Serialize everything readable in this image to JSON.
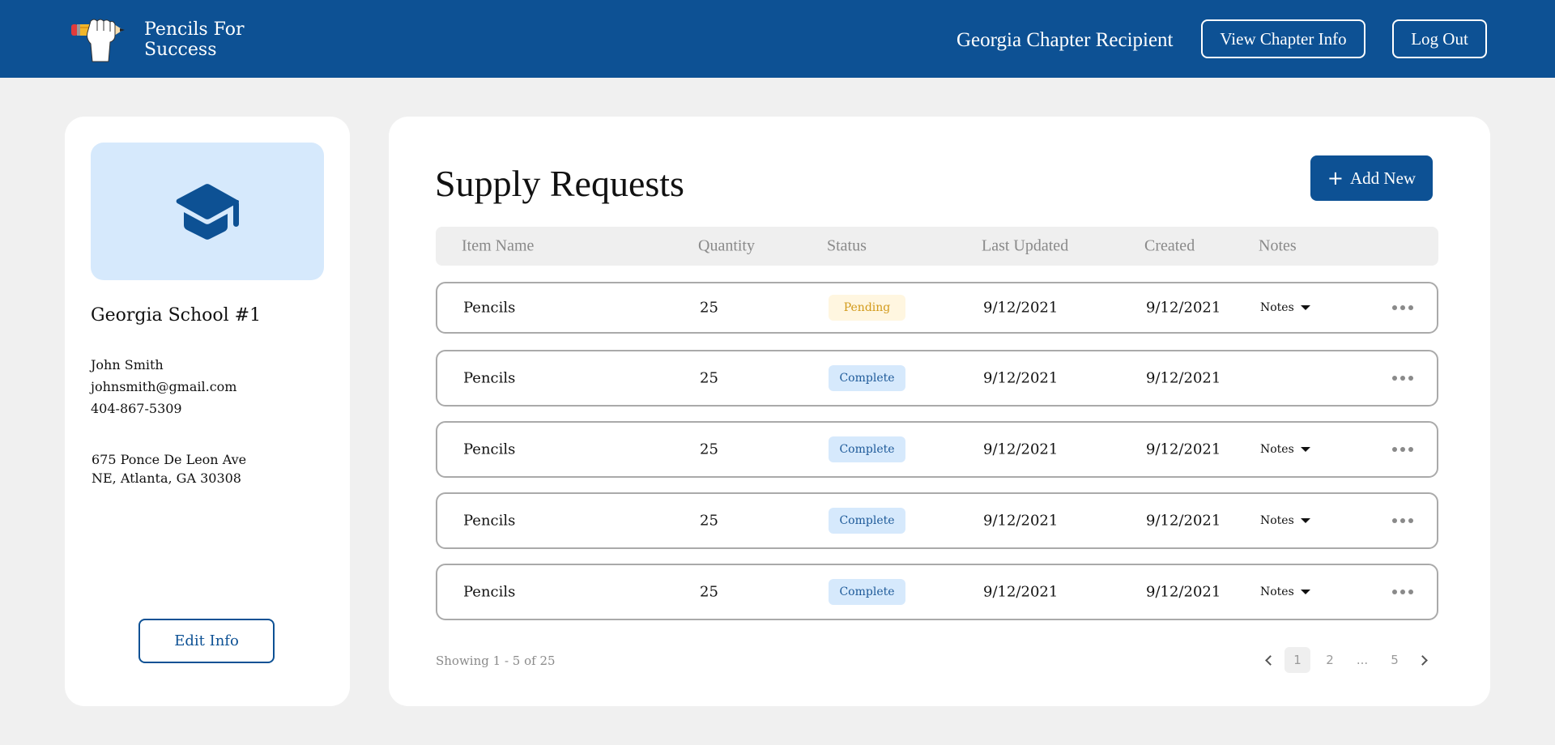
{
  "header": {
    "brand": "Pencils For Success",
    "brand_line1": "Pencils For",
    "brand_line2": "Success",
    "logo_icon": "pencil-fist-logo",
    "role_label": "Georgia Chapter Recipient",
    "view_chapter_label": "View Chapter Info",
    "logout_label": "Log Out",
    "brand_color": "#0d5194"
  },
  "profile": {
    "icon": "graduation-cap-icon",
    "school_name": "Georgia School #1",
    "contact_name": "John Smith",
    "email": "johnsmith@gmail.com",
    "phone": "404-867-5309",
    "address_line1": "675 Ponce De Leon Ave",
    "address_line2": "NE, Atlanta, GA 30308",
    "edit_label": "Edit Info"
  },
  "main": {
    "title": "Supply Requests",
    "add_new_label": "Add New",
    "add_new_icon": "plus-icon",
    "columns": [
      "Item Name",
      "Quantity",
      "Status",
      "Last Updated",
      "Created",
      "Notes"
    ],
    "rows": [
      {
        "item": "Pencils",
        "quantity": "25",
        "status": "Pending",
        "status_type": "pending",
        "last_updated": "9/12/2021",
        "created": "9/12/2021",
        "notes": "Notes"
      },
      {
        "item": "Pencils",
        "quantity": "25",
        "status": "Complete",
        "status_type": "complete",
        "last_updated": "9/12/2021",
        "created": "9/12/2021",
        "notes": ""
      },
      {
        "item": "Pencils",
        "quantity": "25",
        "status": "Complete",
        "status_type": "complete",
        "last_updated": "9/12/2021",
        "created": "9/12/2021",
        "notes": "Notes"
      },
      {
        "item": "Pencils",
        "quantity": "25",
        "status": "Complete",
        "status_type": "complete",
        "last_updated": "9/12/2021",
        "created": "9/12/2021",
        "notes": "Notes"
      },
      {
        "item": "Pencils",
        "quantity": "25",
        "status": "Complete",
        "status_type": "complete",
        "last_updated": "9/12/2021",
        "created": "9/12/2021",
        "notes": "Notes"
      }
    ],
    "status_colors": {
      "pending": {
        "bg": "#fff6e0",
        "fg": "#d29a1a"
      },
      "complete": {
        "bg": "#d6e9fc",
        "fg": "#1e5a99"
      }
    },
    "showing_text": "Showing 1 - 5 of 25",
    "pagination": {
      "pages": [
        "1",
        "2",
        "...",
        "5"
      ],
      "current": "1"
    }
  }
}
